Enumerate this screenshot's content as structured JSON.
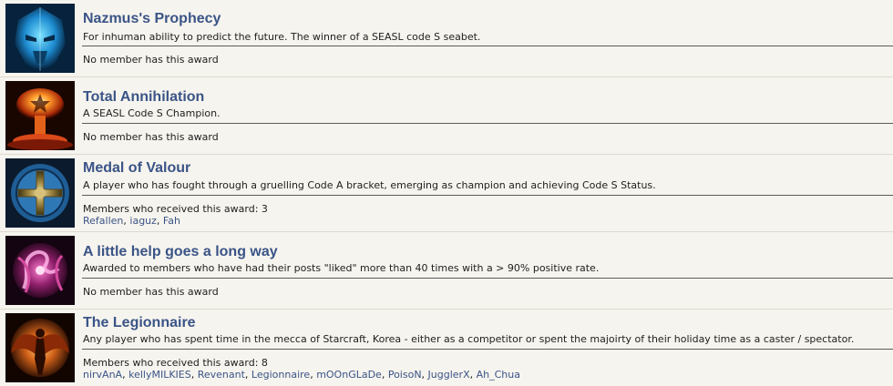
{
  "awards": [
    {
      "icon": "blue-mask-icon",
      "title": "Nazmus's Prophecy",
      "description": "For inhuman ability to predict the future. The winner of a SEASL code S seabet.",
      "status": "No member has this award",
      "members": []
    },
    {
      "icon": "mushroom-cloud-icon",
      "title": "Total Annihilation",
      "description": "A SEASL Code S Champion.",
      "status": "No member has this award",
      "members": []
    },
    {
      "icon": "medal-icon",
      "title": "Medal of Valour",
      "description": "A player who has fought through a gruelling Code A bracket, emerging as champion and achieving Code S Status.",
      "status": "Members who received this award: 3",
      "members": [
        "Refallen",
        "iaguz",
        "Fah"
      ]
    },
    {
      "icon": "pink-tentacle-icon",
      "title": "A little help goes a long way",
      "description": "Awarded to members who have had their posts \"liked\" more than 40 times with a > 90% positive rate.",
      "status": "No member has this award",
      "members": []
    },
    {
      "icon": "winged-figure-icon",
      "title": "The Legionnaire",
      "description": "Any player who has spent time in the mecca of Starcraft, Korea - either as a competitor or spent the majoirty of their holiday time as a caster / spectator.",
      "status": "Members who received this award: 8",
      "members": [
        "nirvAnA",
        "kellyMILKIES",
        "Revenant",
        "Legionnaire",
        "mOOnGLaDe",
        "PoisoN",
        "JugglerX",
        "Ah_Chua"
      ]
    }
  ]
}
